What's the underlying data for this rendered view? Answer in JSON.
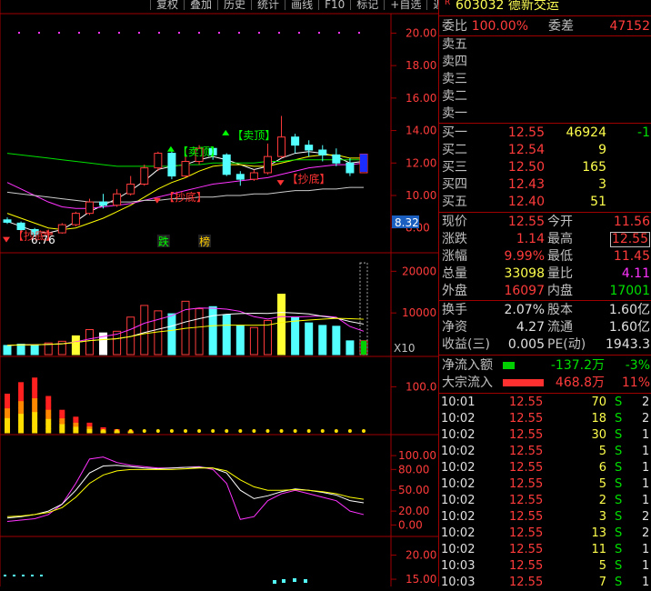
{
  "toolbar": [
    "复权",
    "叠加",
    "历史",
    "统计",
    "画线",
    "F10",
    "标记",
    "+自选",
    "返回"
  ],
  "stock": {
    "flag": "R",
    "code": "603032",
    "name": "德新交运"
  },
  "weibi": {
    "label": "委比",
    "value": "100.00%",
    "diff_label": "委差",
    "diff_value": "47152"
  },
  "asks": [
    {
      "label": "卖五",
      "price": "",
      "vol": ""
    },
    {
      "label": "卖四",
      "price": "",
      "vol": ""
    },
    {
      "label": "卖三",
      "price": "",
      "vol": ""
    },
    {
      "label": "卖二",
      "price": "",
      "vol": ""
    },
    {
      "label": "卖一",
      "price": "",
      "vol": ""
    }
  ],
  "bids": [
    {
      "label": "买一",
      "price": "12.55",
      "vol": "46924",
      "chg": "-1"
    },
    {
      "label": "买二",
      "price": "12.54",
      "vol": "9",
      "chg": ""
    },
    {
      "label": "买三",
      "price": "12.50",
      "vol": "165",
      "chg": ""
    },
    {
      "label": "买四",
      "price": "12.43",
      "vol": "3",
      "chg": ""
    },
    {
      "label": "买五",
      "price": "12.40",
      "vol": "51",
      "chg": ""
    }
  ],
  "quote": [
    {
      "l1": "现价",
      "v1": "12.55",
      "l2": "今开",
      "v2": "11.56"
    },
    {
      "l1": "涨跌",
      "v1": "1.14",
      "l2": "最高",
      "v2": "12.55"
    },
    {
      "l1": "涨幅",
      "v1": "9.99%",
      "l2": "最低",
      "v2": "11.45"
    },
    {
      "l1": "总量",
      "v1": "33098",
      "l2": "量比",
      "v2": "4.11"
    },
    {
      "l1": "外盘",
      "v1": "16097",
      "l2": "内盘",
      "v2": "17001"
    }
  ],
  "fundamentals": [
    {
      "l1": "换手",
      "v1": "2.07%",
      "l2": "股本",
      "v2": "1.60亿"
    },
    {
      "l1": "净资",
      "v1": "4.27",
      "l2": "流通",
      "v2": "1.60亿"
    },
    {
      "l1": "收益(三)",
      "v1": "0.005",
      "l2": "PE(动)",
      "v2": "1943.3"
    }
  ],
  "flows": [
    {
      "label": "净流入额",
      "value": "-137.2万",
      "pct": "-3%",
      "bar_ratio": 0.22
    },
    {
      "label": "大宗流入",
      "value": "468.8万",
      "pct": "11%",
      "bar_ratio": 0.75
    }
  ],
  "ticks": [
    {
      "time": "10:01",
      "price": "12.55",
      "vol": "70",
      "side": "S",
      "n": "2"
    },
    {
      "time": "10:02",
      "price": "12.55",
      "vol": "18",
      "side": "S",
      "n": "2"
    },
    {
      "time": "10:02",
      "price": "12.55",
      "vol": "30",
      "side": "S",
      "n": "1"
    },
    {
      "time": "10:02",
      "price": "12.55",
      "vol": "5",
      "side": "S",
      "n": "1"
    },
    {
      "time": "10:02",
      "price": "12.55",
      "vol": "6",
      "side": "S",
      "n": "1"
    },
    {
      "time": "10:02",
      "price": "12.55",
      "vol": "5",
      "side": "S",
      "n": "1"
    },
    {
      "time": "10:02",
      "price": "12.55",
      "vol": "2",
      "side": "S",
      "n": "1"
    },
    {
      "time": "10:02",
      "price": "12.55",
      "vol": "3",
      "side": "S",
      "n": "2"
    },
    {
      "time": "10:02",
      "price": "12.55",
      "vol": "13",
      "side": "S",
      "n": "2"
    },
    {
      "time": "10:02",
      "price": "12.55",
      "vol": "11",
      "side": "S",
      "n": "1"
    },
    {
      "time": "10:03",
      "price": "12.55",
      "vol": "5",
      "side": "S",
      "n": "1"
    },
    {
      "time": "10:03",
      "price": "12.55",
      "vol": "7",
      "side": "S",
      "n": "1"
    }
  ],
  "chart_data": {
    "type": "candlestick",
    "price_axis": [
      "20.00",
      "18.00",
      "16.00",
      "14.00",
      "12.00",
      "10.00",
      "8.00"
    ],
    "price_range": [
      7.2,
      21.2
    ],
    "last_price_tag": "8.32",
    "low_label": "6.76",
    "annotations": [
      {
        "text": "【卖顶】",
        "x": 16,
        "y": 13.7,
        "color": "#00ff00",
        "kind": "sell"
      },
      {
        "text": "【卖顶】",
        "x": 12,
        "y": 12.7,
        "color": "#00ff00",
        "kind": "sell"
      },
      {
        "text": "【抄底】",
        "x": 11,
        "y": 9.9,
        "color": "#ff3333",
        "kind": "buy"
      },
      {
        "text": "【抄底】",
        "x": 20,
        "y": 11.0,
        "color": "#ff3333",
        "kind": "buy"
      },
      {
        "text": "【抄底】",
        "x": 0,
        "y": 7.5,
        "color": "#ff3333",
        "kind": "buy"
      }
    ],
    "badges": [
      {
        "text": "跌",
        "x": 11
      },
      {
        "text": "榜",
        "x": 14
      }
    ],
    "candles": [
      {
        "o": 8.5,
        "c": 8.35,
        "h": 8.65,
        "l": 8.25
      },
      {
        "o": 8.3,
        "c": 7.9,
        "h": 8.4,
        "l": 7.75
      },
      {
        "o": 7.9,
        "c": 7.6,
        "h": 8.0,
        "l": 7.45
      },
      {
        "o": 7.6,
        "c": 7.7,
        "h": 7.9,
        "l": 7.5
      },
      {
        "o": 7.7,
        "c": 8.2,
        "h": 8.3,
        "l": 7.65
      },
      {
        "o": 8.2,
        "c": 8.9,
        "h": 9.0,
        "l": 8.1
      },
      {
        "o": 8.9,
        "c": 9.6,
        "h": 9.8,
        "l": 8.8
      },
      {
        "o": 9.6,
        "c": 9.4,
        "h": 10.1,
        "l": 9.2
      },
      {
        "o": 9.4,
        "c": 10.1,
        "h": 10.4,
        "l": 9.3
      },
      {
        "o": 10.1,
        "c": 10.7,
        "h": 11.2,
        "l": 10.0
      },
      {
        "o": 10.7,
        "c": 11.7,
        "h": 11.9,
        "l": 10.6
      },
      {
        "o": 11.7,
        "c": 12.6,
        "h": 12.7,
        "l": 11.5
      },
      {
        "o": 12.6,
        "c": 11.2,
        "h": 12.8,
        "l": 11.0
      },
      {
        "o": 11.2,
        "c": 12.1,
        "h": 12.9,
        "l": 11.1
      },
      {
        "o": 12.1,
        "c": 12.9,
        "h": 13.1,
        "l": 11.9
      },
      {
        "o": 12.9,
        "c": 12.5,
        "h": 13.0,
        "l": 12.2
      },
      {
        "o": 12.5,
        "c": 11.3,
        "h": 12.6,
        "l": 11.2
      },
      {
        "o": 11.3,
        "c": 11.0,
        "h": 11.5,
        "l": 10.6
      },
      {
        "o": 11.0,
        "c": 11.4,
        "h": 11.6,
        "l": 10.9
      },
      {
        "o": 11.4,
        "c": 12.4,
        "h": 13.2,
        "l": 11.3
      },
      {
        "o": 12.4,
        "c": 13.6,
        "h": 14.9,
        "l": 12.3
      },
      {
        "o": 13.6,
        "c": 13.1,
        "h": 13.8,
        "l": 12.6
      },
      {
        "o": 13.1,
        "c": 12.8,
        "h": 13.4,
        "l": 12.4
      },
      {
        "o": 12.8,
        "c": 12.5,
        "h": 13.1,
        "l": 12.1
      },
      {
        "o": 12.5,
        "c": 12.0,
        "h": 12.9,
        "l": 11.8
      },
      {
        "o": 12.0,
        "c": 11.4,
        "h": 12.3,
        "l": 11.2
      },
      {
        "o": 11.4,
        "c": 12.55,
        "h": 12.55,
        "l": 11.45
      }
    ],
    "ma_lines": [
      {
        "name": "",
        "color": "#ffffff",
        "values": [
          8.4,
          8.1,
          7.8,
          7.7,
          7.9,
          8.4,
          9.0,
          9.4,
          9.8,
          10.3,
          10.9,
          11.6,
          11.8,
          11.9,
          12.2,
          12.4,
          12.2,
          11.9,
          11.6,
          11.8,
          12.3,
          12.6,
          12.7,
          12.6,
          12.4,
          12.0,
          12.1
        ]
      },
      {
        "name": "",
        "color": "#ffff00",
        "values": [
          8.9,
          8.6,
          8.3,
          8.0,
          7.9,
          8.0,
          8.3,
          8.6,
          9.0,
          9.4,
          9.9,
          10.4,
          10.8,
          11.1,
          11.5,
          11.8,
          11.9,
          11.9,
          11.8,
          11.8,
          12.0,
          12.2,
          12.4,
          12.5,
          12.5,
          12.3,
          12.3
        ]
      },
      {
        "name": "",
        "color": "#ff33ff",
        "values": [
          10.8,
          10.4,
          10.0,
          9.6,
          9.3,
          9.2,
          9.2,
          9.3,
          9.4,
          9.5,
          9.7,
          9.9,
          10.1,
          10.3,
          10.5,
          10.7,
          10.8,
          10.9,
          11.0,
          11.1,
          11.3,
          11.5,
          11.7,
          11.8,
          11.9,
          11.9,
          12.0
        ]
      },
      {
        "name": "",
        "color": "#00e000",
        "values": [
          12.6,
          12.5,
          12.4,
          12.3,
          12.2,
          12.1,
          12.0,
          11.9,
          11.8,
          11.8,
          11.8,
          11.8,
          11.8,
          11.9,
          11.9,
          12.0,
          12.0,
          12.0,
          12.0,
          12.1,
          12.1,
          12.2,
          12.2,
          12.2,
          12.2,
          12.2,
          12.2
        ]
      },
      {
        "name": "",
        "color": "#cccccc",
        "values": [
          10.2,
          10.1,
          10.0,
          9.9,
          9.8,
          9.7,
          9.6,
          9.6,
          9.6,
          9.6,
          9.7,
          9.7,
          9.8,
          9.8,
          9.9,
          9.9,
          10.0,
          10.0,
          10.1,
          10.1,
          10.2,
          10.3,
          10.3,
          10.4,
          10.4,
          10.5,
          10.5
        ]
      }
    ],
    "volume_axis": [
      "20000",
      "10000"
    ],
    "volume_range": [
      0,
      24000
    ],
    "volume_unit": "X10",
    "volumes": [
      2200,
      2500,
      2300,
      2800,
      3200,
      4500,
      6000,
      5200,
      5600,
      9000,
      11800,
      10500,
      9800,
      12800,
      11000,
      11500,
      9500,
      7000,
      6500,
      8200,
      14500,
      9000,
      7600,
      7000,
      6800,
      3300,
      3309
    ],
    "indicator1": {
      "axis": [
        "100.0"
      ],
      "range": [
        0,
        160
      ],
      "values": [
        85,
        110,
        120,
        80,
        50,
        35,
        22,
        12,
        8,
        5,
        3,
        2,
        2,
        2,
        2,
        2,
        2,
        2,
        2,
        2,
        2,
        2,
        2,
        2,
        2,
        2,
        2
      ]
    },
    "indicator2": {
      "axis": [
        "100.00",
        "80.00",
        "50.00",
        "20.00",
        "0.00"
      ],
      "range": [
        -10,
        125
      ],
      "series": [
        {
          "name": "",
          "color": "#ff33ff",
          "values": [
            5,
            7,
            9,
            15,
            30,
            60,
            95,
            98,
            90,
            86,
            84,
            82,
            82,
            83,
            84,
            80,
            60,
            8,
            12,
            35,
            45,
            50,
            45,
            40,
            35,
            20,
            15
          ]
        },
        {
          "name": "",
          "color": "#ffffff",
          "values": [
            10,
            12,
            15,
            20,
            30,
            50,
            75,
            85,
            86,
            84,
            82,
            81,
            82,
            83,
            83,
            82,
            75,
            50,
            38,
            42,
            48,
            52,
            50,
            47,
            43,
            35,
            32
          ]
        },
        {
          "name": "",
          "color": "#ffff00",
          "values": [
            12,
            13,
            15,
            18,
            25,
            40,
            60,
            72,
            78,
            80,
            80,
            80,
            80,
            81,
            82,
            82,
            78,
            65,
            55,
            50,
            50,
            51,
            50,
            48,
            45,
            40,
            37
          ]
        }
      ]
    },
    "indicator3": {
      "axis": [
        "20.00",
        "15.00"
      ],
      "range": [
        13.5,
        23.5
      ]
    }
  }
}
